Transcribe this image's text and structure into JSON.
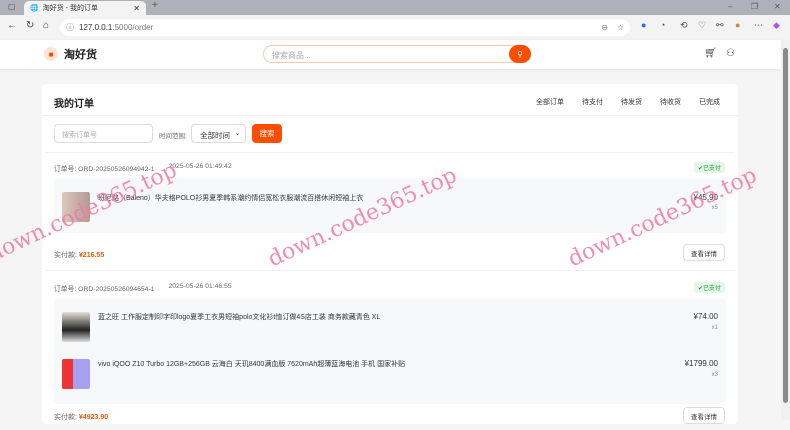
{
  "browser": {
    "tab_title": "淘好货 - 我的订单",
    "url_host": "127.0.0.1",
    "url_path": ":5000/order"
  },
  "header": {
    "brand": "淘好货",
    "search_placeholder": "搜索商品..."
  },
  "page": {
    "title": "我的订单",
    "tabs": [
      "全部订单",
      "待支付",
      "待发货",
      "待收货",
      "已完成"
    ],
    "filter": {
      "order_placeholder": "搜索订单号",
      "time_label": "时间范围:",
      "time_value": "全部时间",
      "search_button": "搜索"
    }
  },
  "orders": [
    {
      "id": "订单号: ORD-20250526094942-1",
      "time": "2025-05-26 01:49:42",
      "status": "已支付",
      "paid_label": "实付款:",
      "paid": "¥216.55",
      "detail": "查看详情",
      "items": [
        {
          "name": "班尼路（Baleno）华夫格POLO衫男夏季韩系潮约情侣宽松衣服潮流百搭休闲短袖上衣",
          "price": "¥45.90",
          "qty": "x5"
        }
      ]
    },
    {
      "id": "订单号: ORD-20250526094654-1",
      "time": "2025-05-26 01:46:55",
      "status": "已支付",
      "paid_label": "实付款:",
      "paid": "¥4923.90",
      "detail": "查看详情",
      "items": [
        {
          "name": "蓝之旺 工作服定制印字印logo夏季工衣男短袖polo文化衫t恤订做4S店工装 商务款藏青色 XL",
          "price": "¥74.00",
          "qty": "x1"
        },
        {
          "name": "vivo iQOO Z10 Turbo 12GB+256GB 云海白 天玑8400满血版 7620mAh超薄蓝海电池 手机 国家补贴",
          "price": "¥1799.00",
          "qty": "x3"
        }
      ]
    }
  ],
  "watermark": "down.code365.top",
  "colors": {
    "accent": "#ff4d00",
    "paid": "#e8590c",
    "status": "#2a9d3d"
  }
}
